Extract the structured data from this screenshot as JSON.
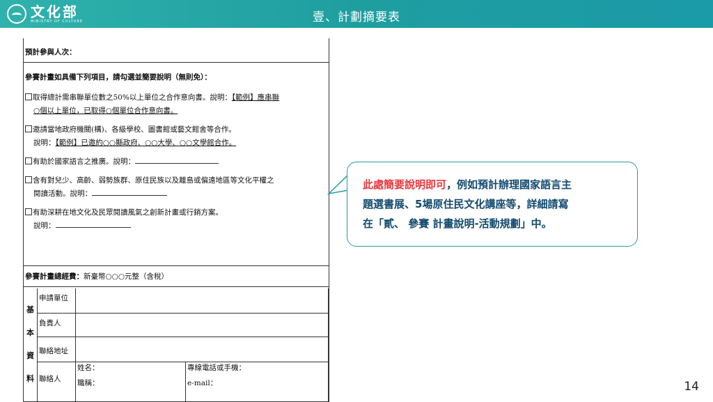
{
  "header": {
    "logo_cn": "文化部",
    "logo_en": "MINISTRY OF CULTURE",
    "title": "壹、計劃摘要表"
  },
  "doc": {
    "participants": "預計參與人次：",
    "items_heading": "參賽計畫如具備下列項目，請勾選並簡要說明（無則免）：",
    "item1_a": "取得總計需串聯單位數之50%以上單位之合作意向書。說明：",
    "item1_ex": "【範例】應串聯",
    "item1_b": "○個以上單位，已取得○個單位合作意向書。",
    "item2_a": "邀請當地政府機關(構)、各級學校、圖書館或藝文館舍等合作。",
    "item2_b_prefix": "說明：",
    "item2_b": "【範例】已邀約○○縣政府、○○大學、○○文學館合作。",
    "item3": "有助於國家語言之推廣。說明：",
    "item4_a": "含有對兒少、高齡、弱勢族群、原住民族以及離島或偏遠地區等文化平權之",
    "item4_b": "閱讀活動。說明：",
    "item5_a": "有助深耕在地文化及民眾閱讀風氣之創新計畫或行銷方案。",
    "item5_b": "說明：",
    "budget_label": "參賽計畫總經費：",
    "budget_value": "新臺幣○○○元整（含稅）",
    "basic_info": [
      "基",
      "本",
      "資",
      "料"
    ],
    "applicant": "申請單位",
    "responsible": "負責人",
    "address": "聯絡地址",
    "contact": "聯絡人",
    "name": "姓名：",
    "title_label": "職稱：",
    "phone": "專線電話或手機：",
    "email": "e-mail："
  },
  "callout": {
    "red": "此處簡要說明即可",
    "line1_rest": "，例如預計辦理國家語言主",
    "line2": "題選書展、5場原住民文化講座等，詳細請寫",
    "line3": "在「貳、 參賽 計畫說明-活動規劃」中。"
  },
  "page_number": "14",
  "colors": {
    "header": "#1f9ea0",
    "callout_border": "#2a9aa0",
    "callout_text": "#134a6e",
    "accent_red": "#e8383d"
  }
}
